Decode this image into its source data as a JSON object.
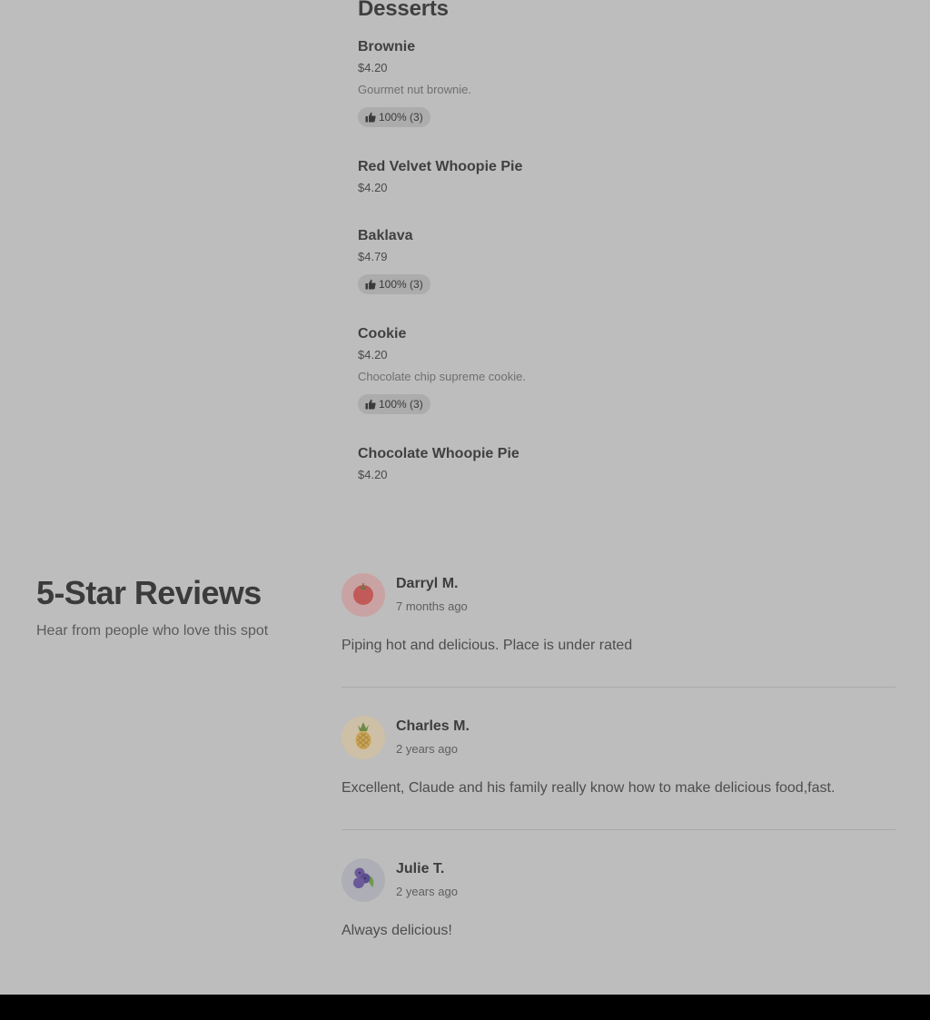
{
  "menu": {
    "section_title": "Desserts",
    "items": [
      {
        "name": "Brownie",
        "price": "$4.20",
        "description": "Gourmet nut brownie.",
        "rating": "100% (3)"
      },
      {
        "name": "Red Velvet Whoopie Pie",
        "price": "$4.20"
      },
      {
        "name": "Baklava",
        "price": "$4.79",
        "rating": "100% (3)"
      },
      {
        "name": "Cookie",
        "price": "$4.20",
        "description": "Chocolate chip supreme cookie.",
        "rating": "100% (3)"
      },
      {
        "name": "Chocolate Whoopie Pie",
        "price": "$4.20"
      }
    ]
  },
  "reviews": {
    "title": "5-Star Reviews",
    "subtitle": "Hear from people who love this spot",
    "items": [
      {
        "name": "Darryl M.",
        "date": "7 months ago",
        "text": "Piping hot and delicious. Place is under rated",
        "avatar_icon": "tomato-icon"
      },
      {
        "name": "Charles M.",
        "date": "2 years ago",
        "text": "Excellent, Claude and his family really know how to make delicious food,fast.",
        "avatar_icon": "pineapple-icon"
      },
      {
        "name": "Julie T.",
        "date": "2 years ago",
        "text": "Always delicious!",
        "avatar_icon": "blueberries-icon"
      }
    ]
  },
  "colors": {
    "overlay_bg": "#bdbdbd",
    "rating_pill_bg": "#acacac",
    "footer_bar": "#000000"
  }
}
